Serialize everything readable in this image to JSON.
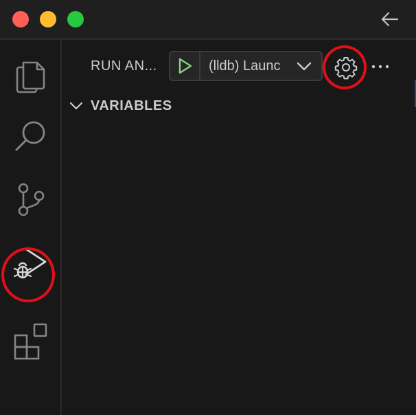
{
  "window": {
    "traffic_lights": {
      "close_color": "#ff5f57",
      "minimize_color": "#febc2e",
      "zoom_color": "#28c840"
    },
    "back_icon": "arrow-left-icon"
  },
  "activity_bar": {
    "items": [
      {
        "name": "explorer",
        "icon": "files-icon",
        "active": false
      },
      {
        "name": "search",
        "icon": "search-icon",
        "active": false
      },
      {
        "name": "source-control",
        "icon": "source-control-icon",
        "active": false
      },
      {
        "name": "run-and-debug",
        "icon": "debug-alt-icon",
        "active": true,
        "highlighted": true
      },
      {
        "name": "extensions",
        "icon": "extensions-icon",
        "active": false
      }
    ]
  },
  "sidebar": {
    "title": "RUN AN...",
    "launch_config": "(lldb) Launc",
    "play_icon": "play-icon",
    "dropdown_icon": "chevron-down-icon",
    "gear_icon": "gear-icon",
    "gear_highlighted": true,
    "more_icon": "ellipsis-icon",
    "sections": [
      {
        "title": "VARIABLES",
        "expanded": true
      }
    ]
  },
  "colors": {
    "background": "#181818",
    "text": "#cccccc",
    "play_green": "#89d185",
    "highlight_red": "#e01018"
  }
}
